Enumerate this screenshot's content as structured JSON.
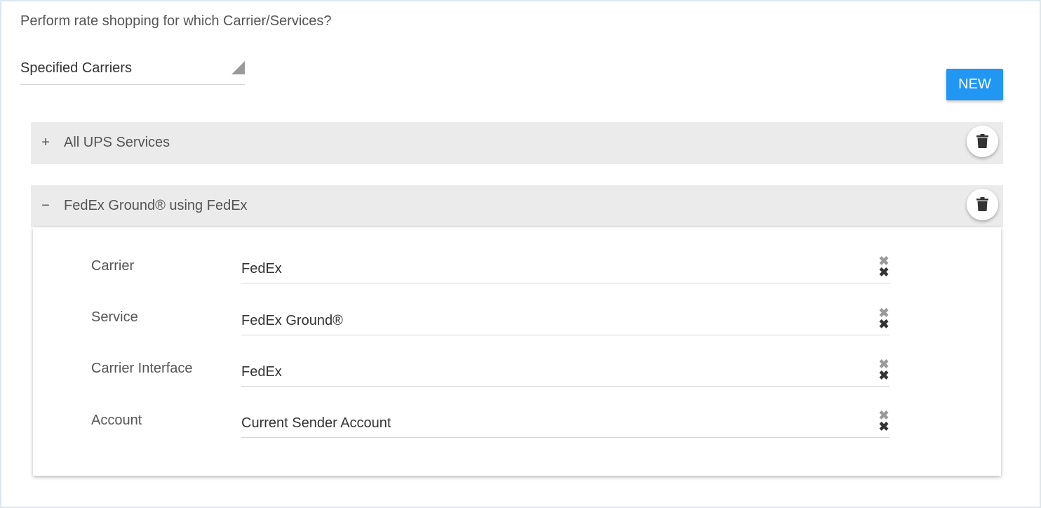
{
  "question": "Perform rate shopping for which Carrier/Services?",
  "carrier_select": {
    "value": "Specified Carriers"
  },
  "new_button": "NEW",
  "panels": [
    {
      "toggle": "+",
      "title": "All UPS Services",
      "expanded": false,
      "delete_icon": "trash-icon"
    },
    {
      "toggle": "−",
      "title": "FedEx Ground® using FedEx",
      "expanded": true,
      "delete_icon": "trash-icon"
    }
  ],
  "fields": [
    {
      "label": "Carrier",
      "value": "FedEx"
    },
    {
      "label": "Service",
      "value": "FedEx Ground®"
    },
    {
      "label": "Carrier Interface",
      "value": "FedEx"
    },
    {
      "label": "Account",
      "value": "Current Sender Account"
    }
  ],
  "clear_icon": "✖",
  "colors": {
    "accent": "#2196f3",
    "panel_header": "#ebebeb",
    "frame_border": "#dbe8ee"
  }
}
